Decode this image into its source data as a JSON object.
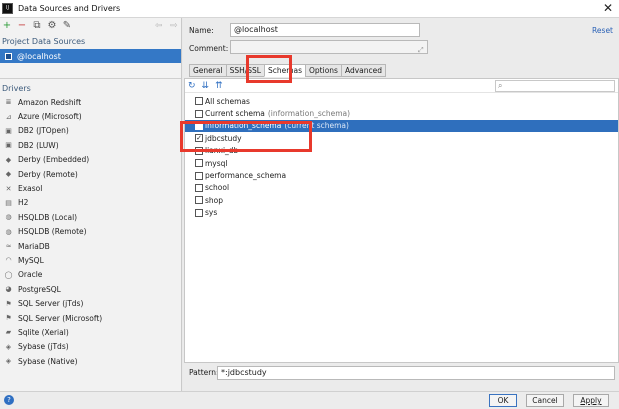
{
  "window": {
    "title": "Data Sources and Drivers"
  },
  "left_toolbar": {
    "add_icon": "+",
    "remove_icon": "−",
    "copy_icon": "⧉",
    "settings_icon": "⚙",
    "edit_icon": "✎",
    "back_icon": "⇦",
    "forward_icon": "⇨"
  },
  "sidebar": {
    "project_header": "Project Data Sources",
    "data_source": "@localhost",
    "drivers_header": "Drivers",
    "drivers": [
      {
        "label": "Amazon Redshift",
        "icon": "≣"
      },
      {
        "label": "Azure (Microsoft)",
        "icon": "⊿"
      },
      {
        "label": "DB2 (JTOpen)",
        "icon": "▣"
      },
      {
        "label": "DB2 (LUW)",
        "icon": "▣"
      },
      {
        "label": "Derby (Embedded)",
        "icon": "◆"
      },
      {
        "label": "Derby (Remote)",
        "icon": "◆"
      },
      {
        "label": "Exasol",
        "icon": "✕"
      },
      {
        "label": "H2",
        "icon": "▤"
      },
      {
        "label": "HSQLDB (Local)",
        "icon": "◍"
      },
      {
        "label": "HSQLDB (Remote)",
        "icon": "◍"
      },
      {
        "label": "MariaDB",
        "icon": "≈"
      },
      {
        "label": "MySQL",
        "icon": "◠"
      },
      {
        "label": "Oracle",
        "icon": "◯"
      },
      {
        "label": "PostgreSQL",
        "icon": "◕"
      },
      {
        "label": "SQL Server (jTds)",
        "icon": "⚑"
      },
      {
        "label": "SQL Server (Microsoft)",
        "icon": "⚑"
      },
      {
        "label": "Sqlite (Xerial)",
        "icon": "▰"
      },
      {
        "label": "Sybase (jTds)",
        "icon": "◈"
      },
      {
        "label": "Sybase (Native)",
        "icon": "◈"
      }
    ]
  },
  "form": {
    "name_label": "Name:",
    "name_value": "@localhost",
    "comment_label": "Comment:",
    "comment_value": "",
    "reset_link": "Reset"
  },
  "tabs": [
    {
      "label": "General",
      "active": false
    },
    {
      "label": "SSH/SSL",
      "active": false
    },
    {
      "label": "Schemas",
      "active": true
    },
    {
      "label": "Options",
      "active": false
    },
    {
      "label": "Advanced",
      "active": false
    }
  ],
  "schemas_toolbar": {
    "refresh_icon": "↻",
    "expand_icon": "⇊",
    "collapse_icon": "⇈",
    "search_icon": "⌕"
  },
  "schemas": [
    {
      "label": "All schemas",
      "checked": false,
      "suffix": "",
      "selected": false
    },
    {
      "label": "Current schema",
      "checked": false,
      "suffix": "(information_schema)",
      "selected": false
    },
    {
      "label": "information_schema",
      "checked": false,
      "suffix": "(current schema)",
      "selected": true
    },
    {
      "label": "jdbcstudy",
      "checked": true,
      "suffix": "",
      "selected": false
    },
    {
      "label": "lianxi_db",
      "checked": false,
      "suffix": "",
      "selected": false
    },
    {
      "label": "mysql",
      "checked": false,
      "suffix": "",
      "selected": false
    },
    {
      "label": "performance_schema",
      "checked": false,
      "suffix": "",
      "selected": false
    },
    {
      "label": "school",
      "checked": false,
      "suffix": "",
      "selected": false
    },
    {
      "label": "shop",
      "checked": false,
      "suffix": "",
      "selected": false
    },
    {
      "label": "sys",
      "checked": false,
      "suffix": "",
      "selected": false
    }
  ],
  "pattern": {
    "label": "Pattern:",
    "value": "*:jdbcstudy"
  },
  "buttons": {
    "help": "?",
    "ok": "OK",
    "cancel": "Cancel",
    "apply": "Apply"
  },
  "colors": {
    "selection": "#3478c6",
    "annotation_box": "#e8392c",
    "link": "#2b62b6"
  }
}
